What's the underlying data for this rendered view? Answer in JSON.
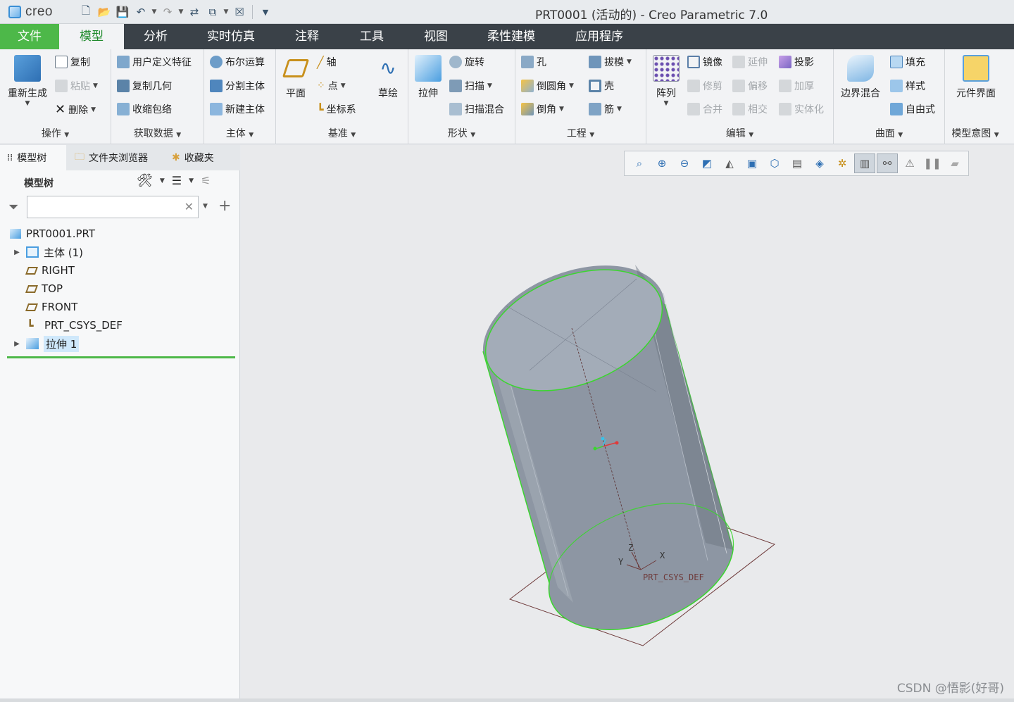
{
  "app": {
    "logo": "creo",
    "window_title": "PRT0001 (活动的) - Creo Parametric 7.0"
  },
  "quick_access": [
    "new-icon",
    "open-icon",
    "save-icon",
    "undo-icon",
    "redo-icon",
    "regenerate-icon",
    "windows-icon",
    "close-window-icon",
    "customize-icon"
  ],
  "tabs": [
    {
      "label": "文件"
    },
    {
      "label": "模型"
    },
    {
      "label": "分析"
    },
    {
      "label": "实时仿真"
    },
    {
      "label": "注释"
    },
    {
      "label": "工具"
    },
    {
      "label": "视图"
    },
    {
      "label": "柔性建模"
    },
    {
      "label": "应用程序"
    }
  ],
  "ribbon": {
    "operations": {
      "label": "操作",
      "regenerate": "重新生成",
      "copy": "复制",
      "paste": "粘贴",
      "delete": "删除"
    },
    "get_data": {
      "label": "获取数据",
      "udf": "用户定义特征",
      "copy_geom": "复制几何",
      "shrinkwrap": "收缩包络"
    },
    "body": {
      "label": "主体",
      "boolean": "布尔运算",
      "split": "分割主体",
      "new_body": "新建主体"
    },
    "datum": {
      "label": "基准",
      "plane": "平面",
      "axis": "轴",
      "point": "点",
      "csys": "坐标系",
      "sketch": "草绘"
    },
    "shapes": {
      "label": "形状",
      "extrude": "拉伸",
      "revolve": "旋转",
      "sweep": "扫描",
      "swept_blend": "扫描混合"
    },
    "engineering": {
      "label": "工程",
      "hole": "孔",
      "draft": "拔模",
      "round": "倒圆角",
      "shell": "壳",
      "chamfer": "倒角",
      "rib": "筋"
    },
    "editing": {
      "label": "编辑",
      "pattern": "阵列",
      "mirror": "镜像",
      "extend": "延伸",
      "project": "投影",
      "trim": "修剪",
      "offset": "偏移",
      "thicken": "加厚",
      "merge": "合并",
      "intersect": "相交",
      "solidify": "实体化"
    },
    "surfaces": {
      "label": "曲面",
      "boundary_blend": "边界混合",
      "fill": "填充",
      "style": "样式",
      "freestyle": "自由式"
    },
    "model_intent": {
      "label": "模型意图",
      "component_interface": "元件界面"
    }
  },
  "panel": {
    "tabs": [
      "模型树",
      "文件夹浏览器",
      "收藏夹"
    ],
    "tree_header": "模型树",
    "search_placeholder": "",
    "tree": [
      {
        "label": "PRT0001.PRT",
        "icon": "part-icon",
        "expander": false
      },
      {
        "label": "主体 (1)",
        "icon": "body-icon",
        "expander": true
      },
      {
        "label": "RIGHT",
        "icon": "datum-plane-icon",
        "expander": false
      },
      {
        "label": "TOP",
        "icon": "datum-plane-icon",
        "expander": false
      },
      {
        "label": "FRONT",
        "icon": "datum-plane-icon",
        "expander": false
      },
      {
        "label": "PRT_CSYS_DEF",
        "icon": "csys-icon",
        "expander": false
      },
      {
        "label": "拉伸 1",
        "icon": "extrude-icon",
        "expander": true,
        "selected": true
      }
    ]
  },
  "viewport": {
    "view_tools": [
      "refit-icon",
      "zoom-in-icon",
      "zoom-out-icon",
      "repaint-icon",
      "display-style-icon",
      "saved-orientations-icon",
      "view-manager-icon",
      "perspective-icon",
      "section-icon",
      "datum-display-icon",
      "annotation-display-icon",
      "spin-center-icon",
      "appearance-icon",
      "pause-icon",
      "blank-icon"
    ],
    "active_tools": [
      "datum-display-icon",
      "annotation-display-icon"
    ],
    "model": {
      "csys_label": "PRT_CSYS_DEF",
      "axis_x": "X",
      "axis_y": "Y",
      "axis_z": "Z",
      "body_color": "#8d96a3",
      "edge_color": "#3bd62f"
    },
    "watermark": "CSDN @悟影(好哥)"
  }
}
